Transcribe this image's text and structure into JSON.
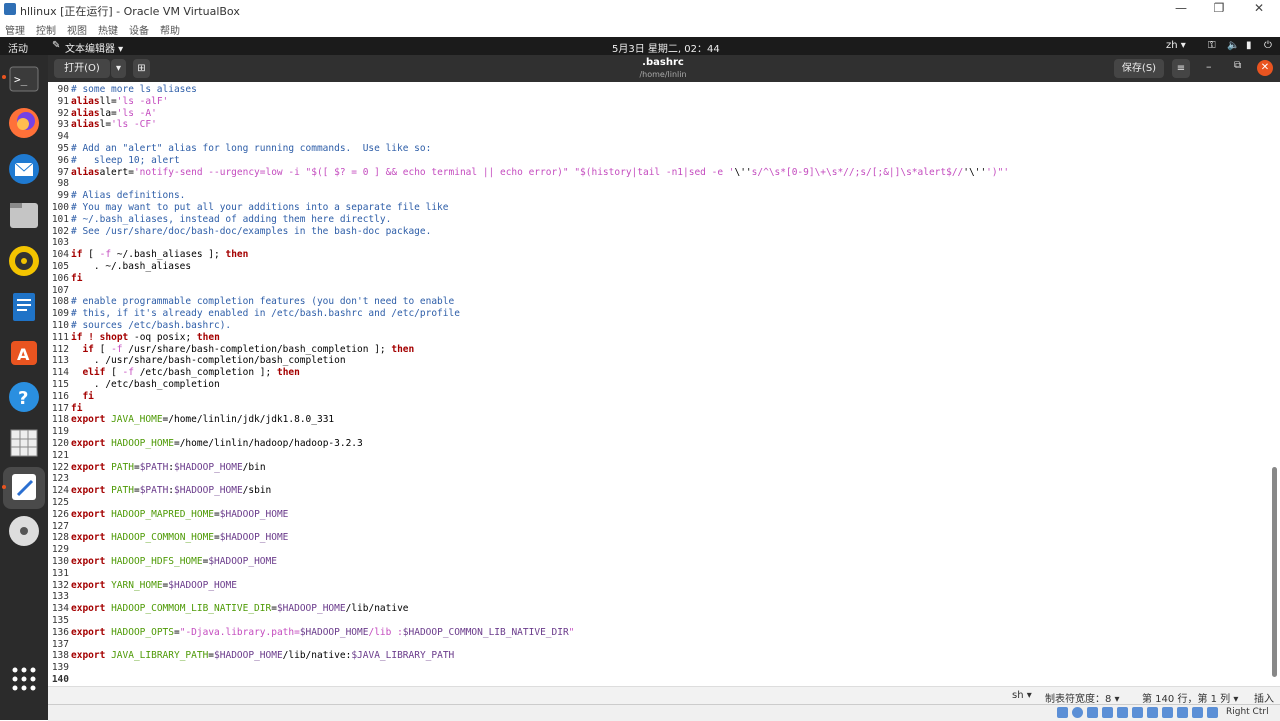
{
  "vbox": {
    "title": "hllinux [正在运行] - Oracle VM VirtualBox",
    "menu": [
      "管理",
      "控制",
      "视图",
      "热键",
      "设备",
      "帮助"
    ],
    "host_key": "Right Ctrl"
  },
  "topbar": {
    "activities": "活动",
    "app_menu": "文本编辑器 ▾",
    "clock": "5月3日 星期二, 02：44",
    "lang": "zh ▾"
  },
  "dock": {
    "apps": [
      "terminal-icon",
      "firefox-icon",
      "thunderbird-icon",
      "files-icon",
      "rhythmbox-icon",
      "writer-icon",
      "software-icon",
      "help-icon",
      "sudoku-icon",
      "text-editor-icon",
      "disc-icon",
      "app-grid-icon"
    ]
  },
  "header": {
    "open_label": "打开(O)",
    "doc_title": ".bashrc",
    "doc_path": "/home/linlin",
    "save_label": "保存(S)"
  },
  "editor": {
    "lines": [
      {
        "n": "90",
        "parts": [
          [
            "c",
            "# some more ls aliases"
          ]
        ]
      },
      {
        "n": "91",
        "parts": [
          [
            "k",
            "alias"
          ],
          [
            "",
            "ll="
          ],
          [
            "s",
            "'ls -alF'"
          ]
        ]
      },
      {
        "n": "92",
        "parts": [
          [
            "k",
            "alias"
          ],
          [
            "",
            "la="
          ],
          [
            "s",
            "'ls -A'"
          ]
        ]
      },
      {
        "n": "93",
        "parts": [
          [
            "k",
            "alias"
          ],
          [
            "",
            "l="
          ],
          [
            "s",
            "'ls -CF'"
          ]
        ]
      },
      {
        "n": "94",
        "parts": []
      },
      {
        "n": "95",
        "parts": [
          [
            "c",
            "# Add an \"alert\" alias for long running commands.  Use like so:"
          ]
        ]
      },
      {
        "n": "96",
        "parts": [
          [
            "c",
            "#   sleep 10; alert"
          ]
        ]
      },
      {
        "n": "97",
        "parts": [
          [
            "k",
            "alias"
          ],
          [
            "",
            "alert="
          ],
          [
            "s",
            "'notify-send --urgency=low -i \"$([ $? = 0 ] && echo terminal || echo error)\" \"$(history|tail -n1|sed -e '"
          ],
          [
            "",
            "\\''"
          ],
          [
            "s",
            "s/^\\s*[0-9]\\+\\s*//;s/[;&|]\\s*alert$//"
          ],
          [
            "",
            "'\\''"
          ],
          [
            "s",
            "')\"'"
          ]
        ]
      },
      {
        "n": "98",
        "parts": []
      },
      {
        "n": "99",
        "parts": [
          [
            "c",
            "# Alias definitions."
          ]
        ]
      },
      {
        "n": "100",
        "parts": [
          [
            "c",
            "# You may want to put all your additions into a separate file like"
          ]
        ]
      },
      {
        "n": "101",
        "parts": [
          [
            "c",
            "# ~/.bash_aliases, instead of adding them here directly."
          ]
        ]
      },
      {
        "n": "102",
        "parts": [
          [
            "c",
            "# See /usr/share/doc/bash-doc/examples in the bash-doc package."
          ]
        ]
      },
      {
        "n": "103",
        "parts": []
      },
      {
        "n": "104",
        "parts": [
          [
            "k",
            "if"
          ],
          [
            "",
            " [ "
          ],
          [
            "s",
            "-f"
          ],
          [
            "",
            " ~/.bash_aliases ]; "
          ],
          [
            "k",
            "then"
          ]
        ]
      },
      {
        "n": "105",
        "parts": [
          [
            "",
            "    . ~/.bash_aliases"
          ]
        ]
      },
      {
        "n": "106",
        "parts": [
          [
            "k",
            "fi"
          ]
        ]
      },
      {
        "n": "107",
        "parts": []
      },
      {
        "n": "108",
        "parts": [
          [
            "c",
            "# enable programmable completion features (you don't need to enable"
          ]
        ]
      },
      {
        "n": "109",
        "parts": [
          [
            "c",
            "# this, if it's already enabled in /etc/bash.bashrc and /etc/profile"
          ]
        ]
      },
      {
        "n": "110",
        "parts": [
          [
            "c",
            "# sources /etc/bash.bashrc)."
          ]
        ]
      },
      {
        "n": "111",
        "parts": [
          [
            "k",
            "if"
          ],
          [
            "",
            " "
          ],
          [
            "k",
            "!"
          ],
          [
            "",
            " "
          ],
          [
            "k",
            "shopt"
          ],
          [
            "",
            " -oq posix; "
          ],
          [
            "k",
            "then"
          ]
        ]
      },
      {
        "n": "112",
        "parts": [
          [
            "",
            "  "
          ],
          [
            "k",
            "if"
          ],
          [
            "",
            " [ "
          ],
          [
            "s",
            "-f"
          ],
          [
            "",
            " /usr/share/bash-completion/bash_completion ]; "
          ],
          [
            "k",
            "then"
          ]
        ]
      },
      {
        "n": "113",
        "parts": [
          [
            "",
            "    . /usr/share/bash-completion/bash_completion"
          ]
        ]
      },
      {
        "n": "114",
        "parts": [
          [
            "",
            "  "
          ],
          [
            "k",
            "elif"
          ],
          [
            "",
            " [ "
          ],
          [
            "s",
            "-f"
          ],
          [
            "",
            " /etc/bash_completion ]; "
          ],
          [
            "k",
            "then"
          ]
        ]
      },
      {
        "n": "115",
        "parts": [
          [
            "",
            "    . /etc/bash_completion"
          ]
        ]
      },
      {
        "n": "116",
        "parts": [
          [
            "",
            "  "
          ],
          [
            "k",
            "fi"
          ]
        ]
      },
      {
        "n": "117",
        "parts": [
          [
            "k",
            "fi"
          ]
        ]
      },
      {
        "n": "118",
        "parts": [
          [
            "k",
            "export"
          ],
          [
            "",
            " "
          ],
          [
            "v",
            "JAVA_HOME"
          ],
          [
            "",
            "=/home/linlin/jdk/jdk1.8.0_331"
          ]
        ]
      },
      {
        "n": "119",
        "parts": []
      },
      {
        "n": "120",
        "parts": [
          [
            "k",
            "export"
          ],
          [
            "",
            " "
          ],
          [
            "v",
            "HADOOP_HOME"
          ],
          [
            "",
            "=/home/linlin/hadoop/hadoop-3.2.3"
          ]
        ]
      },
      {
        "n": "121",
        "parts": []
      },
      {
        "n": "122",
        "parts": [
          [
            "k",
            "export"
          ],
          [
            "",
            " "
          ],
          [
            "v",
            "PATH"
          ],
          [
            "",
            "="
          ],
          [
            "m",
            "$PATH"
          ],
          [
            "",
            ":"
          ],
          [
            "m",
            "$HADOOP_HOME"
          ],
          [
            "",
            "/bin"
          ]
        ]
      },
      {
        "n": "123",
        "parts": []
      },
      {
        "n": "124",
        "parts": [
          [
            "k",
            "export"
          ],
          [
            "",
            " "
          ],
          [
            "v",
            "PATH"
          ],
          [
            "",
            "="
          ],
          [
            "m",
            "$PATH"
          ],
          [
            "",
            ":"
          ],
          [
            "m",
            "$HADOOP_HOME"
          ],
          [
            "",
            "/sbin"
          ]
        ]
      },
      {
        "n": "125",
        "parts": []
      },
      {
        "n": "126",
        "parts": [
          [
            "k",
            "export"
          ],
          [
            "",
            " "
          ],
          [
            "v",
            "HADOOP_MAPRED_HOME"
          ],
          [
            "",
            "="
          ],
          [
            "m",
            "$HADOOP_HOME"
          ]
        ]
      },
      {
        "n": "127",
        "parts": []
      },
      {
        "n": "128",
        "parts": [
          [
            "k",
            "export"
          ],
          [
            "",
            " "
          ],
          [
            "v",
            "HADOOP_COMMON_HOME"
          ],
          [
            "",
            "="
          ],
          [
            "m",
            "$HADOOP_HOME"
          ]
        ]
      },
      {
        "n": "129",
        "parts": []
      },
      {
        "n": "130",
        "parts": [
          [
            "k",
            "export"
          ],
          [
            "",
            " "
          ],
          [
            "v",
            "HADOOP_HDFS_HOME"
          ],
          [
            "",
            "="
          ],
          [
            "m",
            "$HADOOP_HOME"
          ]
        ]
      },
      {
        "n": "131",
        "parts": []
      },
      {
        "n": "132",
        "parts": [
          [
            "k",
            "export"
          ],
          [
            "",
            " "
          ],
          [
            "v",
            "YARN_HOME"
          ],
          [
            "",
            "="
          ],
          [
            "m",
            "$HADOOP_HOME"
          ]
        ]
      },
      {
        "n": "133",
        "parts": []
      },
      {
        "n": "134",
        "parts": [
          [
            "k",
            "export"
          ],
          [
            "",
            " "
          ],
          [
            "v",
            "HADOOP_COMMOM_LIB_NATIVE_DIR"
          ],
          [
            "",
            "="
          ],
          [
            "m",
            "$HADOOP_HOME"
          ],
          [
            "",
            "/lib/native"
          ]
        ]
      },
      {
        "n": "135",
        "parts": []
      },
      {
        "n": "136",
        "parts": [
          [
            "k",
            "export"
          ],
          [
            "",
            " "
          ],
          [
            "v",
            "HADOOP_OPTS"
          ],
          [
            "",
            "="
          ],
          [
            "s",
            "\"-Djava.library.path="
          ],
          [
            "m",
            "$HADOOP_HOME"
          ],
          [
            "s",
            "/lib :"
          ],
          [
            "m",
            "$HADOOP_COMMON_LIB_NATIVE_DIR"
          ],
          [
            "s",
            "\""
          ]
        ]
      },
      {
        "n": "137",
        "parts": []
      },
      {
        "n": "138",
        "parts": [
          [
            "k",
            "export"
          ],
          [
            "",
            " "
          ],
          [
            "v",
            "JAVA_LIBRARY_PATH"
          ],
          [
            "",
            "="
          ],
          [
            "m",
            "$HADOOP_HOME"
          ],
          [
            "",
            "/lib/native:"
          ],
          [
            "m",
            "$JAVA_LIBRARY_PATH"
          ]
        ]
      },
      {
        "n": "139",
        "parts": []
      },
      {
        "n": "140",
        "parts": []
      }
    ]
  },
  "status": {
    "lang": "sh ▾",
    "tab_width": "制表符宽度：8 ▾",
    "position": "第 140 行，第 1 列 ▾",
    "mode": "插入"
  },
  "colors": {
    "dock_bg": "#2b2b2b",
    "topbar_bg": "#1b1b1b",
    "accent": "#e95420"
  }
}
